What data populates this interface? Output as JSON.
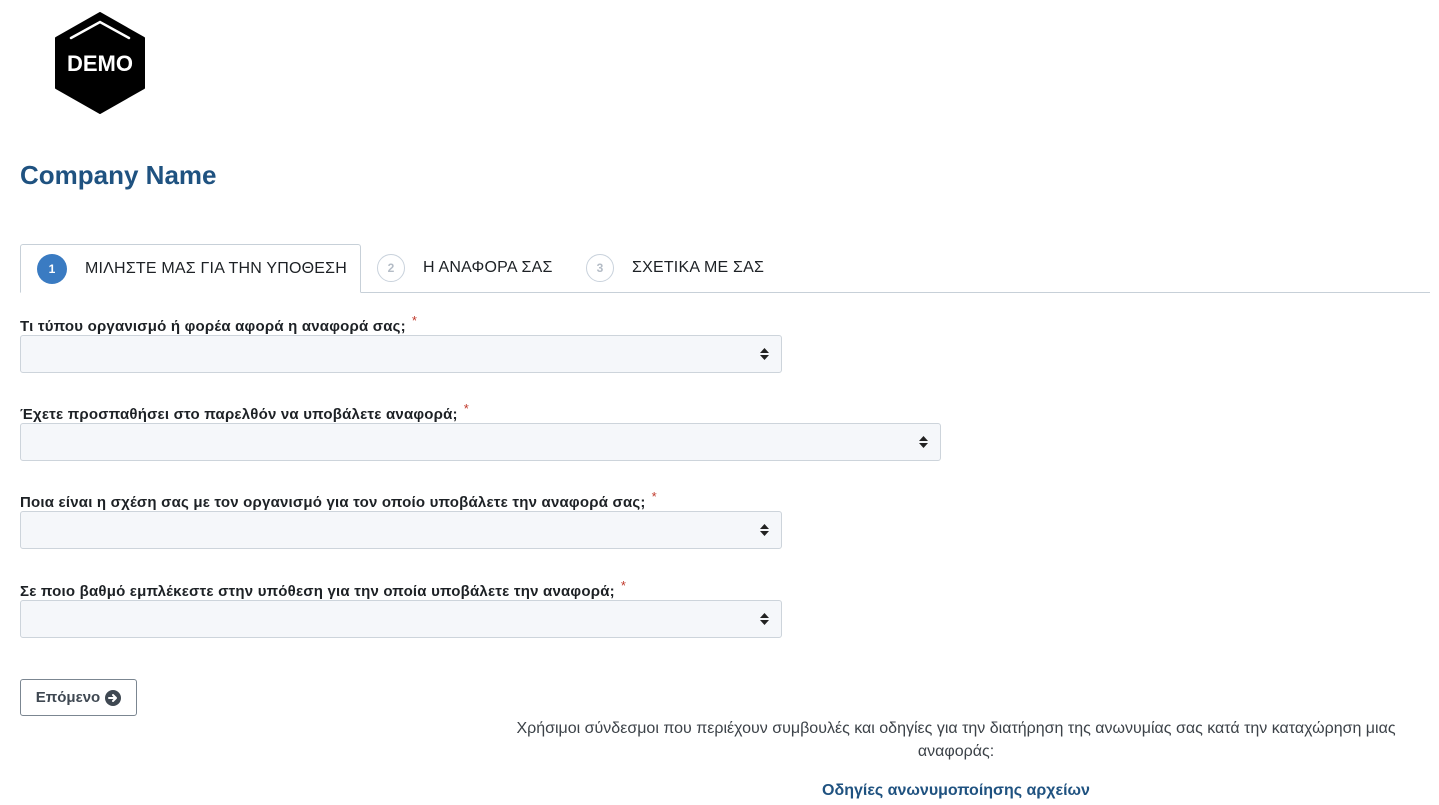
{
  "logo": {
    "text": "DEMO"
  },
  "company": {
    "name": "Company Name"
  },
  "tabs": [
    {
      "number": "1",
      "label": "ΜΙΛΗΣΤΕ ΜΑΣ ΓΙΑ ΤΗΝ ΥΠΟΘΕΣΗ",
      "active": true
    },
    {
      "number": "2",
      "label": "Η ΑΝΑΦΟΡΑ ΣΑΣ",
      "active": false
    },
    {
      "number": "3",
      "label": "ΣΧΕΤΙΚΑ ΜΕ ΣΑΣ",
      "active": false
    }
  ],
  "questions": [
    {
      "label": "Τι τύπου οργανισμό ή φορέα αφορά η αναφορά σας;",
      "required_mark": "*",
      "value": ""
    },
    {
      "label": "Έχετε προσπαθήσει στο παρελθόν να υποβάλετε αναφορά;",
      "required_mark": "*",
      "value": ""
    },
    {
      "label": "Ποια είναι η σχέση σας με τον οργανισμό για τον οποίο υποβάλετε την αναφορά σας;",
      "required_mark": "*",
      "value": ""
    },
    {
      "label": "Σε ποιο βαθμό εμπλέκεστε στην υπόθεση για την οποία υποβάλετε την αναφορά;",
      "required_mark": "*",
      "value": ""
    }
  ],
  "next_button": {
    "label": "Επόμενο",
    "icon": "arrow-circle-right-icon"
  },
  "help": {
    "text": "Χρήσιμοι σύνδεσμοι που περιέχουν συμβουλές και οδηγίες για την διατήρηση της ανωνυμίας σας κατά την καταχώρηση μιας αναφοράς:",
    "link": "Οδηγίες ανωνυμοποίησης αρχείων"
  },
  "colors": {
    "brand": "#1f5280",
    "active_step": "#3a7bc2",
    "required": "#c0392b"
  }
}
